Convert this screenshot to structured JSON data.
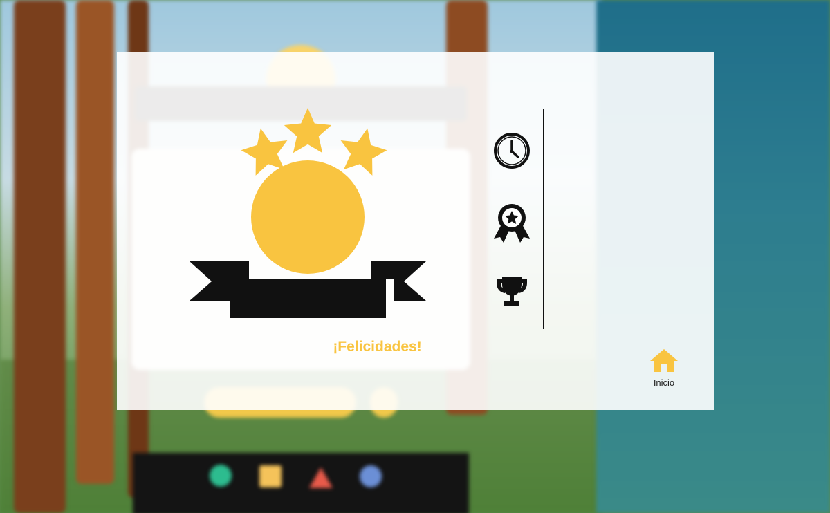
{
  "modal": {
    "title": "¡Felicidades!",
    "stats": [
      {
        "icon": "clock-icon"
      },
      {
        "icon": "award-ribbon-icon"
      },
      {
        "icon": "trophy-icon"
      }
    ],
    "home": {
      "label": "Inicio",
      "icon": "home-icon"
    }
  },
  "colors": {
    "gold": "#f9c440",
    "black": "#111111",
    "overlay": "#ffffff"
  }
}
